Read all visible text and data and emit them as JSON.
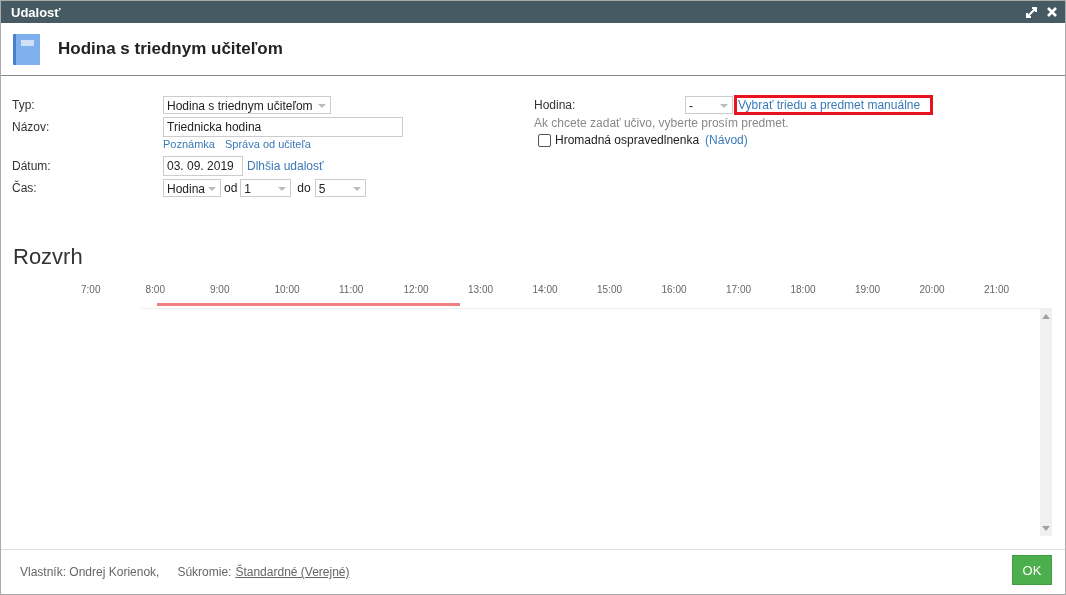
{
  "window": {
    "title": "Udalosť"
  },
  "header": {
    "title": "Hodina s triednym učiteľom"
  },
  "form": {
    "type": {
      "label": "Typ:",
      "value": "Hodina s triednym učiteľom"
    },
    "name": {
      "label": "Názov:",
      "value": "Triednicka hodina",
      "links": [
        "Poznámka",
        "Správa od učiteľa"
      ]
    },
    "date": {
      "label": "Dátum:",
      "value": "03. 09. 2019",
      "link": "Dlhšia udalosť"
    },
    "time": {
      "label": "Čas:",
      "unit": "Hodina",
      "from_label": "od",
      "from": "1",
      "to_label": "do",
      "to": "5"
    },
    "lesson": {
      "label": "Hodina:",
      "value": "-",
      "link": "Vybrať triedu a predmet manuálne",
      "highlighted": true,
      "hint": "Ak chcete zadať učivo, vyberte prosím predmet."
    },
    "bulk_excuse": {
      "label": "Hromadná ospravedlnenka",
      "checked": false,
      "link": "(Návod)"
    }
  },
  "schedule": {
    "title": "Rozvrh",
    "hours": [
      "7:00",
      "8:00",
      "9:00",
      "10:00",
      "11:00",
      "12:00",
      "13:00",
      "14:00",
      "15:00",
      "16:00",
      "17:00",
      "18:00",
      "19:00",
      "20:00",
      "21:00"
    ]
  },
  "footer": {
    "owner": "Vlastník: Ondrej Korienok,",
    "privacy_label": "Súkromie:",
    "privacy_value": "Štandardné (Verejné)",
    "ok": "OK"
  }
}
